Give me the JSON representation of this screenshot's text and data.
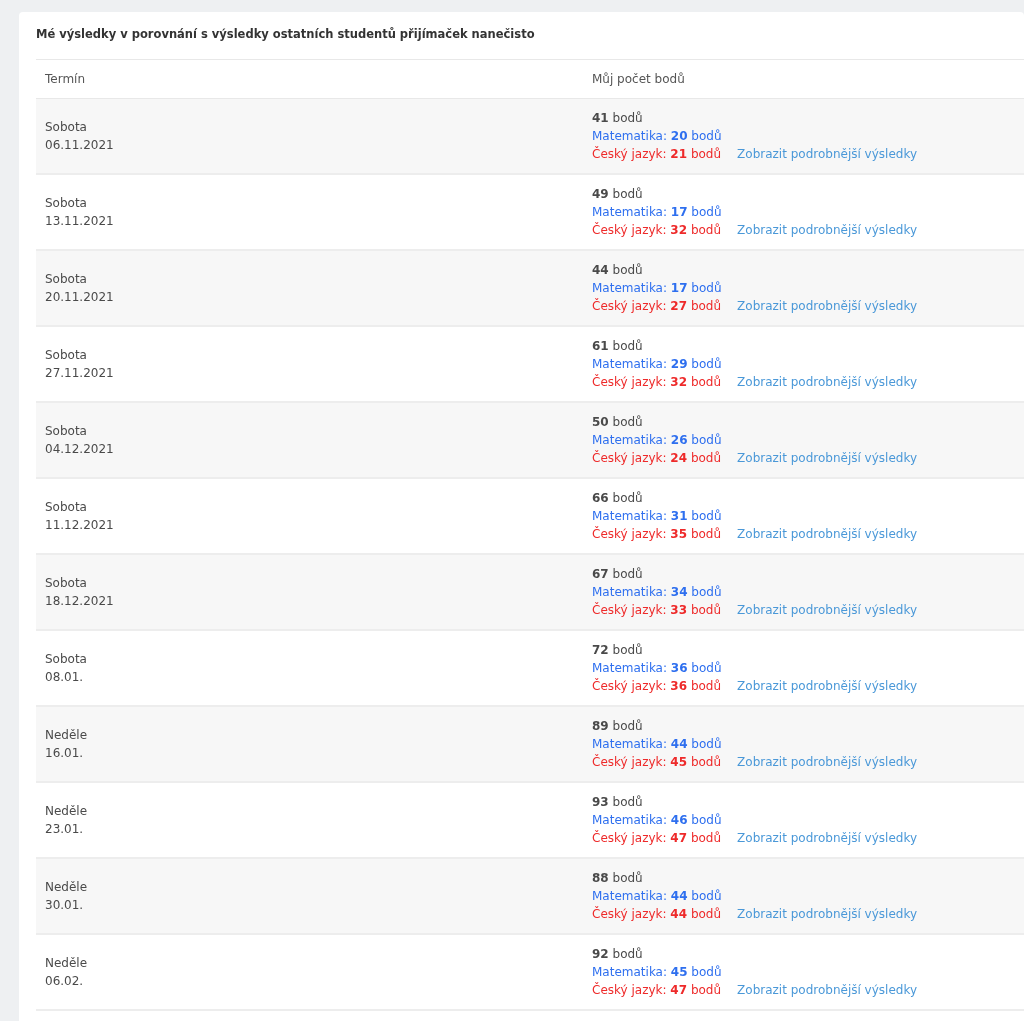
{
  "title": "Mé výsledky v porovnání s výsledky ostatních studentů přijímaček nanečisto",
  "columns": [
    "Termín",
    "Můj počet bodů"
  ],
  "rows": [
    {
      "day": "Sobota",
      "date": "06.11.2021",
      "total": "**41** bodů",
      "math": "Matematika: **20** bodů",
      "czech": "Český jazyk: **21** bodů",
      "link": "Zobrazit podrobnější výsledky"
    },
    {
      "day": "Sobota",
      "date": "13.11.2021",
      "total": "**49** bodů",
      "math": "Matematika: **17** bodů",
      "czech": "Český jazyk: **32** bodů",
      "link": "Zobrazit podrobnější výsledky"
    },
    {
      "day": "Sobota",
      "date": "20.11.2021",
      "total": "**44** bodů",
      "math": "Matematika: **17** bodů",
      "czech": "Český jazyk: **27** bodů",
      "link": "Zobrazit podrobnější výsledky"
    },
    {
      "day": "Sobota",
      "date": "27.11.2021",
      "total": "**61** bodů",
      "math": "Matematika: **29** bodů",
      "czech": "Český jazyk: **32** bodů",
      "link": "Zobrazit podrobnější výsledky"
    },
    {
      "day": "Sobota",
      "date": "04.12.2021",
      "total": "**50** bodů",
      "math": "Matematika: **26** bodů",
      "czech": "Český jazyk: **24** bodů",
      "link": "Zobrazit podrobnější výsledky"
    },
    {
      "day": "Sobota",
      "date": "11.12.2021",
      "total": "**66** bodů",
      "math": "Matematika: **31** bodů",
      "czech": "Český jazyk: **35** bodů",
      "link": "Zobrazit podrobnější výsledky"
    },
    {
      "day": "Sobota",
      "date": "18.12.2021",
      "total": "**67** bodů",
      "math": "Matematika: **34** bodů",
      "czech": "Český jazyk: **33** bodů",
      "link": "Zobrazit podrobnější výsledky"
    },
    {
      "day": "Sobota",
      "date": "08.01.",
      "total": "**72** bodů",
      "math": "Matematika: **36** bodů",
      "czech": "Český jazyk: **36** bodů",
      "link": "Zobrazit podrobnější výsledky"
    },
    {
      "day": "Neděle",
      "date": "16.01.",
      "total": "**89** bodů",
      "math": "Matematika: **44** bodů",
      "czech": "Český jazyk: **45** bodů",
      "link": "Zobrazit podrobnější výsledky"
    },
    {
      "day": "Neděle",
      "date": "23.01.",
      "total": "**93** bodů",
      "math": "Matematika: **46** bodů",
      "czech": "Český jazyk: **47** bodů",
      "link": "Zobrazit podrobnější výsledky"
    },
    {
      "day": "Neděle",
      "date": "30.01.",
      "total": "**88** bodů",
      "math": "Matematika: **44** bodů",
      "czech": "Český jazyk: **44** bodů",
      "link": "Zobrazit podrobnější výsledky"
    },
    {
      "day": "Neděle",
      "date": "06.02.",
      "total": "**92** bodů",
      "math": "Matematika: **45** bodů",
      "czech": "Český jazyk: **47** bodů",
      "link": "Zobrazit podrobnější výsledky"
    }
  ]
}
